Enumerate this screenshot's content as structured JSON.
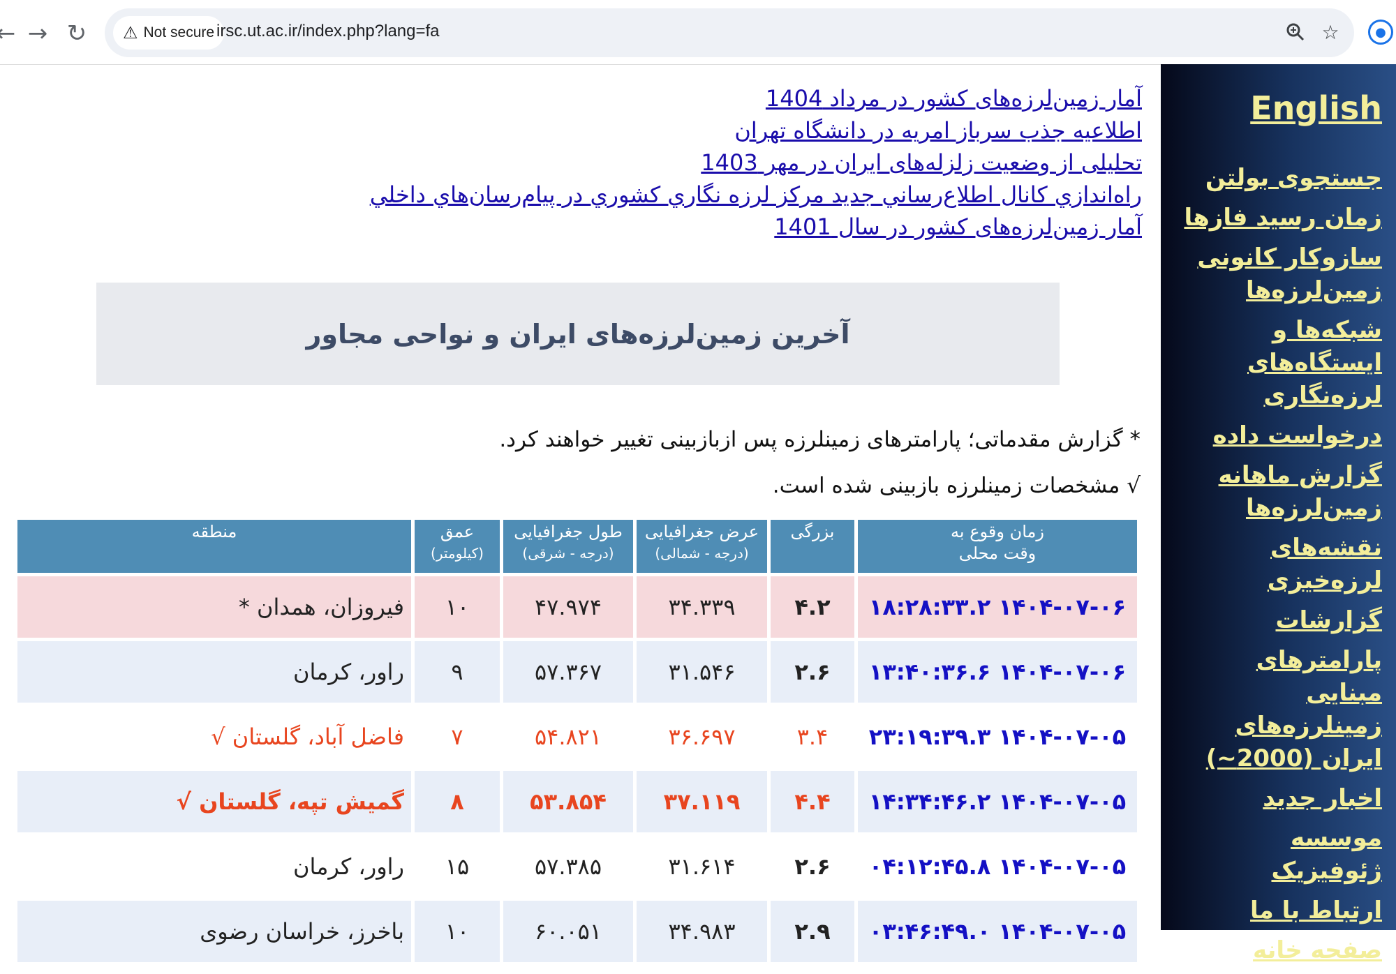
{
  "browser": {
    "security_label": "Not secure",
    "url": "irsc.ut.ac.ir/index.php?lang=fa"
  },
  "sidebar": {
    "english": "English",
    "items": [
      "جستجوی بولتن",
      "زمان رسید فازها",
      "سازوکار کانونی زمین‌لرزه‌ها",
      "شبکه‌ها و ایستگاه‌های لرزه‌نگاری",
      "درخواست داده",
      "گزارش ماهانه زمین‌لرزه‌ها",
      "نقشه‌های لرزه‌خیزی",
      "گزارشات",
      "پارامترهای مبنایی زمینلرزه‌های ایران (2000~)",
      "اخبار جدید",
      "موسسه ژئوفیزیک",
      "ارتباط با ما",
      "صفحه خانه"
    ]
  },
  "news": [
    "آمار زمین‌لرزه‌های کشور در مرداد 1404",
    "اطلاعیه جذب سرباز امریه در دانشگاه تهران",
    "تحلیلی از وضعیت زلزله‌های ایران در مهر 1403",
    "راه‌اندازي کانال اطلاع‌رساني جديد مرکز لرزه نگاري کشوري در پيام‌رسان‌هاي داخلي",
    "آمار زمین‌لرزه‌های کشور در سال 1401"
  ],
  "title": "آخرین زمین‌لرزه‌های ایران و نواحی مجاور",
  "notes": {
    "preliminary": "* گزارش مقدماتی؛ پارامترهای زمینلرزه پس ازبازبینی تغییر خواهند کرد.",
    "reviewed": "√ مشخصات زمینلرزه بازبینی شده است."
  },
  "table": {
    "headers": {
      "time": "زمان وقوع به",
      "time_sub": "وقت محلی",
      "magnitude": "بزرگی",
      "latitude": "عرض جغرافیایی",
      "latitude_sub": "(درجه - شمالی)",
      "longitude": "طول جغرافیایی",
      "longitude_sub": "(درجه - شرقی)",
      "depth": "عمق",
      "depth_sub": "(کیلومتر)",
      "region": "منطقه"
    },
    "rows": [
      {
        "time": "۱۴۰۴-۰۷-۰۶ ۱۸:۲۸:۳۳.۲",
        "mag": "۴.۲",
        "lat": "۳۴.۳۳۹",
        "lon": "۴۷.۹۷۴",
        "depth": "۱۰",
        "region": "فیروزان، همدان *"
      },
      {
        "time": "۱۴۰۴-۰۷-۰۶ ۱۳:۴۰:۳۶.۶",
        "mag": "۲.۶",
        "lat": "۳۱.۵۴۶",
        "lon": "۵۷.۳۶۷",
        "depth": "۹",
        "region": "راور، کرمان"
      },
      {
        "time": "۱۴۰۴-۰۷-۰۵ ۲۳:۱۹:۳۹.۳",
        "mag": "۳.۴",
        "lat": "۳۶.۶۹۷",
        "lon": "۵۴.۸۲۱",
        "depth": "۷",
        "region": "فاضل آباد، گلستان √"
      },
      {
        "time": "۱۴۰۴-۰۷-۰۵ ۱۴:۳۴:۴۶.۲",
        "mag": "۴.۴",
        "lat": "۳۷.۱۱۹",
        "lon": "۵۳.۸۵۴",
        "depth": "۸",
        "region": "گمیش تپه، گلستان √"
      },
      {
        "time": "۱۴۰۴-۰۷-۰۵ ۰۴:۱۲:۴۵.۸",
        "mag": "۲.۶",
        "lat": "۳۱.۶۱۴",
        "lon": "۵۷.۳۸۵",
        "depth": "۱۵",
        "region": "راور، کرمان"
      },
      {
        "time": "۱۴۰۴-۰۷-۰۵ ۰۳:۴۶:۴۹.۰",
        "mag": "۲.۹",
        "lat": "۳۴.۹۸۳",
        "lon": "۶۰.۰۵۱",
        "depth": "۱۰",
        "region": "باخرز، خراسان رضوی"
      }
    ]
  },
  "colors": {
    "header_bg": "#4f8db5",
    "row_highlight": "#f6d9dc",
    "row_alt": "#e8eef8",
    "link": "#1a0dab",
    "sidebar_link": "#f3ee9a",
    "reviewed_red": "#e8451f",
    "time_blue": "#1410c4"
  },
  "icons": {
    "back": "back-arrow-icon",
    "forward": "forward-arrow-icon",
    "reload": "reload-icon",
    "warning": "warning-triangle-icon",
    "zoom": "zoom-icon",
    "bookmark": "star-icon",
    "profile": "profile-icon"
  }
}
